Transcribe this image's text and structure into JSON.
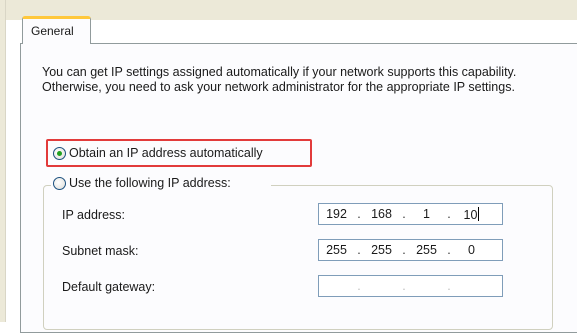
{
  "tabs": [
    {
      "label": "General"
    }
  ],
  "description": "You can get IP settings assigned automatically if your network supports this capability. Otherwise, you need to ask your network administrator for the appropriate IP settings.",
  "radios": {
    "auto": {
      "label": "Obtain an IP address automatically",
      "checked": true
    },
    "manual": {
      "label": "Use the following IP address:",
      "checked": false
    }
  },
  "fields": {
    "ip_address": {
      "label": "IP address:",
      "octets": [
        "192",
        "168",
        "1",
        "10"
      ]
    },
    "subnet_mask": {
      "label": "Subnet mask:",
      "octets": [
        "255",
        "255",
        "255",
        "0"
      ]
    },
    "default_gateway": {
      "label": "Default gateway:",
      "octets": [
        "",
        "",
        "",
        ""
      ]
    }
  },
  "colors": {
    "highlight": "#e23b3b",
    "tab_accent": "#ffc83c",
    "radio_dot": "#21a121"
  }
}
